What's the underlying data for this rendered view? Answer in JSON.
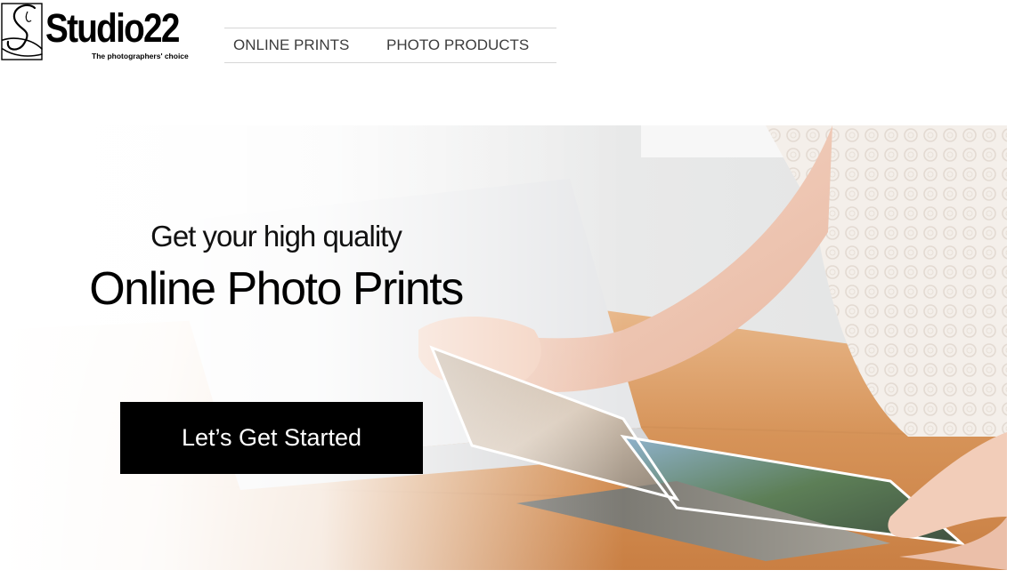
{
  "header": {
    "logo": {
      "wordmark": "Studio22",
      "tagline": "The photographers' choice"
    },
    "nav": [
      {
        "label": "ONLINE PRINTS"
      },
      {
        "label": "PHOTO PRODUCTS"
      }
    ]
  },
  "hero": {
    "subtitle": "Get your high quality",
    "title": "Online Photo Prints",
    "cta_label": "Let’s Get Started"
  },
  "colors": {
    "nav_text": "#3c3c3c",
    "cta_background": "#000000",
    "cta_text": "#ffffff",
    "nav_border": "#d6d6d6"
  }
}
